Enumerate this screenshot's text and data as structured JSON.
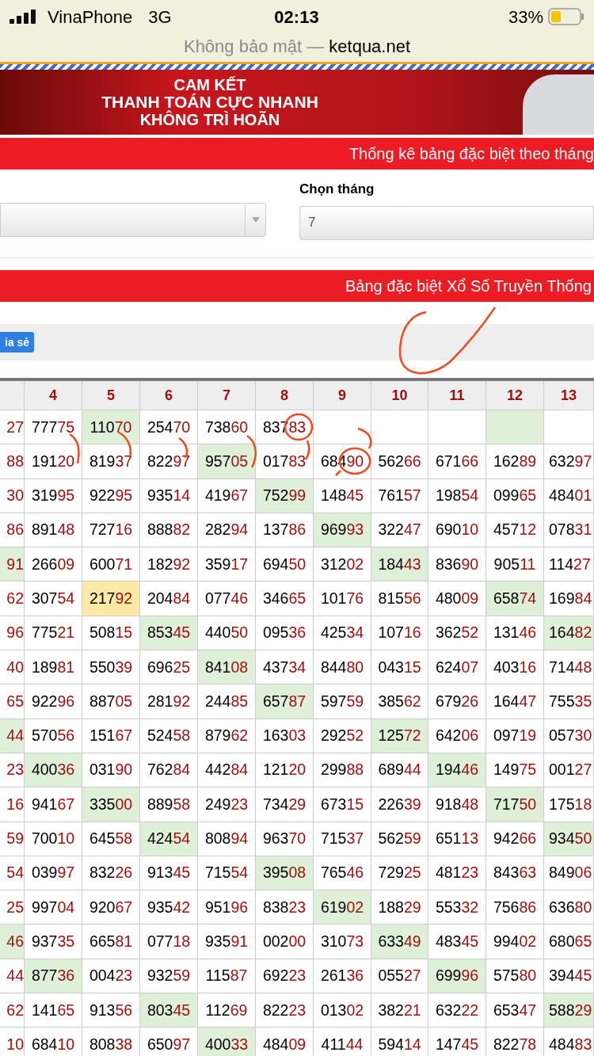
{
  "status_bar": {
    "carrier": "VinaPhone",
    "network": "3G",
    "time": "02:13",
    "battery": "33%",
    "security": "Không bảo mật —",
    "domain": "ketqua.net"
  },
  "banner": {
    "lines": [
      "CAM KẾT",
      "THANH TOÁN CỰC NHANH",
      "KHÔNG TRÌ HOÃN"
    ]
  },
  "stats_bar": {
    "title": "Thống kê bảng đặc biệt theo tháng"
  },
  "form": {
    "month_select": {
      "label": "Chọn tháng",
      "value": "7"
    }
  },
  "table_bar": {
    "title": "Bảng đặc biệt Xổ Số Truyền Thống"
  },
  "share_button": {
    "label": "ia sẻ"
  },
  "table": {
    "columns": [
      "",
      "4",
      "5",
      "6",
      "7",
      "8",
      "9",
      "10",
      "11",
      "12",
      "13"
    ],
    "rows": [
      [
        {
          "tail": "27"
        },
        {
          "head": "777",
          "tail": "75"
        },
        {
          "head": "110",
          "tail": "70",
          "color": "#dff0d8"
        },
        {
          "head": "254",
          "tail": "70"
        },
        {
          "head": "738",
          "tail": "60"
        },
        {
          "head": "837",
          "tail": "83"
        },
        {},
        {},
        {},
        {
          "color": "#dff0d8"
        },
        {}
      ],
      [
        {
          "tail": "88"
        },
        {
          "head": "191",
          "tail": "20"
        },
        {
          "head": "819",
          "tail": "37"
        },
        {
          "head": "822",
          "tail": "97"
        },
        {
          "head": "957",
          "tail": "05",
          "color": "#dff0d8"
        },
        {
          "head": "017",
          "tail": "83"
        },
        {
          "head": "684",
          "tail": "90"
        },
        {
          "head": "562",
          "tail": "66"
        },
        {
          "head": "671",
          "tail": "66"
        },
        {
          "head": "162",
          "tail": "89"
        },
        {
          "head": "632",
          "tail": "97"
        }
      ],
      [
        {
          "tail": "30"
        },
        {
          "head": "319",
          "tail": "95"
        },
        {
          "head": "922",
          "tail": "95"
        },
        {
          "head": "935",
          "tail": "14"
        },
        {
          "head": "419",
          "tail": "67"
        },
        {
          "head": "752",
          "tail": "99",
          "color": "#dff0d8"
        },
        {
          "head": "148",
          "tail": "45"
        },
        {
          "head": "761",
          "tail": "57"
        },
        {
          "head": "198",
          "tail": "54"
        },
        {
          "head": "099",
          "tail": "65"
        },
        {
          "head": "484",
          "tail": "01"
        }
      ],
      [
        {
          "tail": "86"
        },
        {
          "head": "891",
          "tail": "48"
        },
        {
          "head": "727",
          "tail": "16"
        },
        {
          "head": "888",
          "tail": "82"
        },
        {
          "head": "282",
          "tail": "94"
        },
        {
          "head": "137",
          "tail": "86"
        },
        {
          "head": "969",
          "tail": "93",
          "color": "#dff0d8"
        },
        {
          "head": "322",
          "tail": "47"
        },
        {
          "head": "690",
          "tail": "10"
        },
        {
          "head": "457",
          "tail": "12"
        },
        {
          "head": "078",
          "tail": "31"
        }
      ],
      [
        {
          "tail": "91",
          "color": "#dff0d8"
        },
        {
          "head": "266",
          "tail": "09"
        },
        {
          "head": "600",
          "tail": "71"
        },
        {
          "head": "182",
          "tail": "92"
        },
        {
          "head": "359",
          "tail": "17"
        },
        {
          "head": "694",
          "tail": "50"
        },
        {
          "head": "312",
          "tail": "02"
        },
        {
          "head": "184",
          "tail": "43",
          "color": "#dff0d8"
        },
        {
          "head": "836",
          "tail": "90"
        },
        {
          "head": "905",
          "tail": "11"
        },
        {
          "head": "114",
          "tail": "27"
        }
      ],
      [
        {
          "tail": "62"
        },
        {
          "head": "307",
          "tail": "54"
        },
        {
          "head": "217",
          "tail": "92",
          "color": "#fde9a6"
        },
        {
          "head": "204",
          "tail": "84"
        },
        {
          "head": "077",
          "tail": "46"
        },
        {
          "head": "346",
          "tail": "65"
        },
        {
          "head": "101",
          "tail": "76"
        },
        {
          "head": "815",
          "tail": "56"
        },
        {
          "head": "480",
          "tail": "09"
        },
        {
          "head": "658",
          "tail": "74",
          "color": "#dff0d8"
        },
        {
          "head": "169",
          "tail": "84"
        }
      ],
      [
        {
          "tail": "96"
        },
        {
          "head": "775",
          "tail": "21"
        },
        {
          "head": "508",
          "tail": "15"
        },
        {
          "head": "853",
          "tail": "45",
          "color": "#dff0d8"
        },
        {
          "head": "440",
          "tail": "50"
        },
        {
          "head": "095",
          "tail": "36"
        },
        {
          "head": "425",
          "tail": "34"
        },
        {
          "head": "107",
          "tail": "16"
        },
        {
          "head": "362",
          "tail": "52"
        },
        {
          "head": "131",
          "tail": "46"
        },
        {
          "head": "164",
          "tail": "82",
          "color": "#dff0d8"
        }
      ],
      [
        {
          "tail": "40"
        },
        {
          "head": "189",
          "tail": "81"
        },
        {
          "head": "550",
          "tail": "39"
        },
        {
          "head": "696",
          "tail": "25"
        },
        {
          "head": "841",
          "tail": "08",
          "color": "#dff0d8"
        },
        {
          "head": "437",
          "tail": "34"
        },
        {
          "head": "844",
          "tail": "80"
        },
        {
          "head": "043",
          "tail": "15"
        },
        {
          "head": "624",
          "tail": "07"
        },
        {
          "head": "403",
          "tail": "16"
        },
        {
          "head": "714",
          "tail": "48"
        }
      ],
      [
        {
          "tail": "65"
        },
        {
          "head": "922",
          "tail": "96"
        },
        {
          "head": "887",
          "tail": "05"
        },
        {
          "head": "281",
          "tail": "92"
        },
        {
          "head": "244",
          "tail": "85"
        },
        {
          "head": "657",
          "tail": "87",
          "color": "#dff0d8"
        },
        {
          "head": "597",
          "tail": "59"
        },
        {
          "head": "385",
          "tail": "62"
        },
        {
          "head": "679",
          "tail": "26"
        },
        {
          "head": "164",
          "tail": "47"
        },
        {
          "head": "755",
          "tail": "35"
        }
      ],
      [
        {
          "tail": "44",
          "color": "#dff0d8"
        },
        {
          "head": "570",
          "tail": "56"
        },
        {
          "head": "151",
          "tail": "67"
        },
        {
          "head": "524",
          "tail": "58"
        },
        {
          "head": "879",
          "tail": "62"
        },
        {
          "head": "163",
          "tail": "03"
        },
        {
          "head": "292",
          "tail": "52"
        },
        {
          "head": "125",
          "tail": "72",
          "color": "#dff0d8"
        },
        {
          "head": "642",
          "tail": "06"
        },
        {
          "head": "097",
          "tail": "19"
        },
        {
          "head": "057",
          "tail": "30"
        }
      ],
      [
        {
          "tail": "23"
        },
        {
          "head": "400",
          "tail": "36",
          "color": "#dff0d8"
        },
        {
          "head": "031",
          "tail": "90"
        },
        {
          "head": "762",
          "tail": "84"
        },
        {
          "head": "442",
          "tail": "84"
        },
        {
          "head": "121",
          "tail": "20"
        },
        {
          "head": "299",
          "tail": "88"
        },
        {
          "head": "689",
          "tail": "44"
        },
        {
          "head": "194",
          "tail": "46",
          "color": "#dff0d8"
        },
        {
          "head": "149",
          "tail": "75"
        },
        {
          "head": "001",
          "tail": "27"
        }
      ],
      [
        {
          "tail": "16"
        },
        {
          "head": "941",
          "tail": "67"
        },
        {
          "head": "335",
          "tail": "00",
          "color": "#dff0d8"
        },
        {
          "head": "889",
          "tail": "58"
        },
        {
          "head": "249",
          "tail": "23"
        },
        {
          "head": "734",
          "tail": "29"
        },
        {
          "head": "673",
          "tail": "15"
        },
        {
          "head": "226",
          "tail": "39"
        },
        {
          "head": "918",
          "tail": "48"
        },
        {
          "head": "717",
          "tail": "50",
          "color": "#dff0d8"
        },
        {
          "head": "175",
          "tail": "18"
        }
      ],
      [
        {
          "tail": "59"
        },
        {
          "head": "700",
          "tail": "10"
        },
        {
          "head": "645",
          "tail": "58"
        },
        {
          "head": "424",
          "tail": "54",
          "color": "#dff0d8"
        },
        {
          "head": "808",
          "tail": "94"
        },
        {
          "head": "963",
          "tail": "70"
        },
        {
          "head": "715",
          "tail": "37"
        },
        {
          "head": "562",
          "tail": "59"
        },
        {
          "head": "651",
          "tail": "13"
        },
        {
          "head": "942",
          "tail": "66"
        },
        {
          "head": "934",
          "tail": "50",
          "color": "#dff0d8"
        }
      ],
      [
        {
          "tail": "54"
        },
        {
          "head": "039",
          "tail": "97"
        },
        {
          "head": "832",
          "tail": "26"
        },
        {
          "head": "913",
          "tail": "45"
        },
        {
          "head": "715",
          "tail": "54"
        },
        {
          "head": "395",
          "tail": "08",
          "color": "#dff0d8"
        },
        {
          "head": "765",
          "tail": "46"
        },
        {
          "head": "729",
          "tail": "25"
        },
        {
          "head": "481",
          "tail": "23"
        },
        {
          "head": "843",
          "tail": "63"
        },
        {
          "head": "849",
          "tail": "06"
        }
      ],
      [
        {
          "tail": "25"
        },
        {
          "head": "997",
          "tail": "04"
        },
        {
          "head": "920",
          "tail": "67"
        },
        {
          "head": "935",
          "tail": "42"
        },
        {
          "head": "951",
          "tail": "96"
        },
        {
          "head": "838",
          "tail": "23"
        },
        {
          "head": "619",
          "tail": "02",
          "color": "#dff0d8"
        },
        {
          "head": "188",
          "tail": "29"
        },
        {
          "head": "553",
          "tail": "32"
        },
        {
          "head": "756",
          "tail": "86"
        },
        {
          "head": "636",
          "tail": "80"
        }
      ],
      [
        {
          "tail": "46",
          "color": "#dff0d8"
        },
        {
          "head": "937",
          "tail": "35"
        },
        {
          "head": "665",
          "tail": "81"
        },
        {
          "head": "077",
          "tail": "18"
        },
        {
          "head": "935",
          "tail": "91"
        },
        {
          "head": "002",
          "tail": "00"
        },
        {
          "head": "310",
          "tail": "73"
        },
        {
          "head": "633",
          "tail": "49",
          "color": "#dff0d8"
        },
        {
          "head": "483",
          "tail": "45"
        },
        {
          "head": "994",
          "tail": "02"
        },
        {
          "head": "680",
          "tail": "65"
        }
      ],
      [
        {
          "tail": "44"
        },
        {
          "head": "877",
          "tail": "36",
          "color": "#dff0d8"
        },
        {
          "head": "004",
          "tail": "23"
        },
        {
          "head": "932",
          "tail": "59"
        },
        {
          "head": "115",
          "tail": "87"
        },
        {
          "head": "692",
          "tail": "23"
        },
        {
          "head": "261",
          "tail": "36"
        },
        {
          "head": "055",
          "tail": "27"
        },
        {
          "head": "699",
          "tail": "96",
          "color": "#dff0d8"
        },
        {
          "head": "575",
          "tail": "80"
        },
        {
          "head": "394",
          "tail": "45"
        }
      ],
      [
        {
          "tail": "62"
        },
        {
          "head": "141",
          "tail": "65"
        },
        {
          "head": "913",
          "tail": "56"
        },
        {
          "head": "803",
          "tail": "45",
          "color": "#dff0d8"
        },
        {
          "head": "112",
          "tail": "69"
        },
        {
          "head": "822",
          "tail": "23"
        },
        {
          "head": "013",
          "tail": "02"
        },
        {
          "head": "382",
          "tail": "21"
        },
        {
          "head": "632",
          "tail": "22"
        },
        {
          "head": "653",
          "tail": "47"
        },
        {
          "head": "588",
          "tail": "29",
          "color": "#dff0d8"
        }
      ],
      [
        {
          "tail": "10"
        },
        {
          "head": "684",
          "tail": "10"
        },
        {
          "head": "808",
          "tail": "38"
        },
        {
          "head": "650",
          "tail": "97"
        },
        {
          "head": "400",
          "tail": "33",
          "color": "#dff0d8"
        },
        {
          "head": "484",
          "tail": "09"
        },
        {
          "head": "411",
          "tail": "44"
        },
        {
          "head": "594",
          "tail": "14"
        },
        {
          "head": "147",
          "tail": "45"
        },
        {
          "head": "822",
          "tail": "78"
        },
        {
          "head": "484",
          "tail": "83"
        }
      ]
    ]
  }
}
